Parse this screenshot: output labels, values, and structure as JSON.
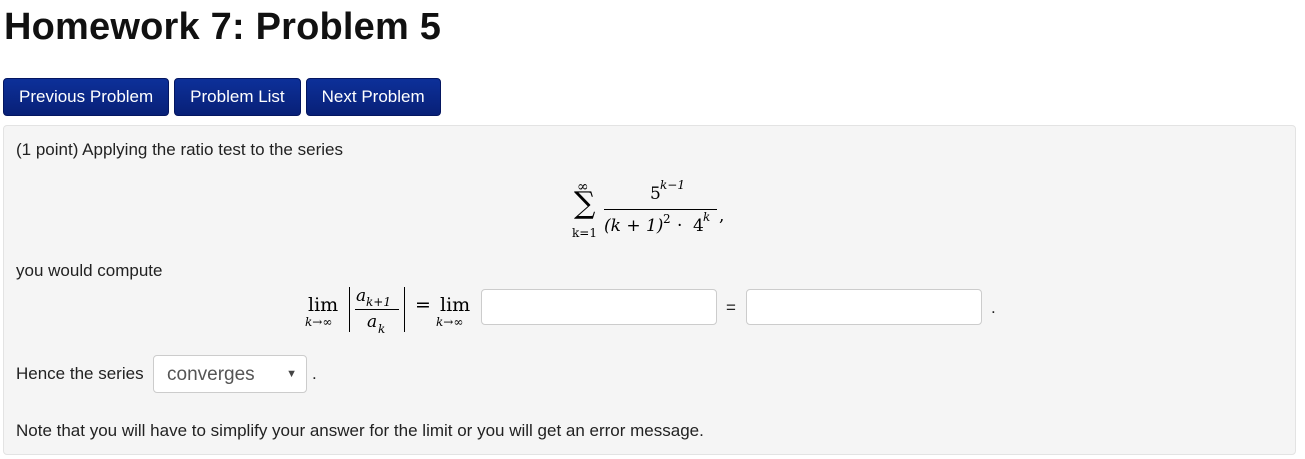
{
  "page": {
    "title": "Homework 7: Problem 5"
  },
  "nav": {
    "previous_label": "Previous Problem",
    "list_label": "Problem List",
    "next_label": "Next Problem"
  },
  "problem": {
    "intro": "(1 point) Applying the ratio test to the series",
    "series": {
      "sum_upper": "∞",
      "sum_symbol": "∑",
      "sum_lower": "k=1",
      "numerator": "5",
      "numerator_exp": "k−1",
      "denominator_base": "(k + 1)",
      "denominator_base_exp": "2",
      "denominator_dot": "·",
      "denominator_factor": "4",
      "denominator_factor_exp": "k",
      "trailing": ","
    },
    "compute_text": "you would compute",
    "limit": {
      "lim_word": "lim",
      "lim_sub": "k→∞",
      "ratio_numerator": "a",
      "ratio_numerator_sub": "k+1",
      "ratio_denominator": "a",
      "ratio_denominator_sub": "k",
      "equals": "=",
      "lim_word_2": "lim",
      "lim_sub_2": "k→∞",
      "equals_2": "=",
      "period": "."
    },
    "answer_1": {
      "value": "",
      "placeholder": ""
    },
    "answer_2": {
      "value": "",
      "placeholder": ""
    },
    "hence_text": "Hence the series",
    "conclusion_select": {
      "selected": "converges"
    },
    "hence_period": ".",
    "note": "Note that you will have to simplify your answer for the limit or you will get an error message."
  },
  "icons": {
    "dropdown": "chevron-down-icon"
  }
}
